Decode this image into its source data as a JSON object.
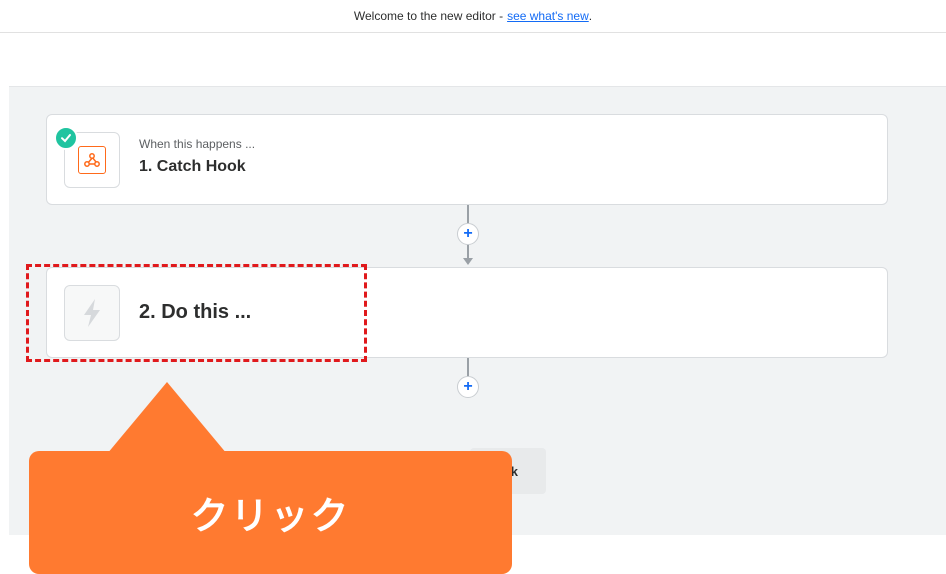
{
  "banner": {
    "text": "Welcome to the new editor -",
    "link": "see what's new",
    "period": "."
  },
  "steps": [
    {
      "subtitle": "When this happens ...",
      "title": "1. Catch Hook",
      "icon": "webhook-icon",
      "status": "complete"
    },
    {
      "title": "2. Do this ...",
      "icon": "lightning-bolt-icon"
    }
  ],
  "add_step": {
    "symbol": "+"
  },
  "partial_button": {
    "label": "k"
  },
  "callout": {
    "label": "クリック"
  },
  "colors": {
    "accent": "#136bf5",
    "webhook": "#ff6a1a",
    "check": "#20c4a0",
    "highlight": "#e0191c",
    "callout": "#ff7a30"
  }
}
